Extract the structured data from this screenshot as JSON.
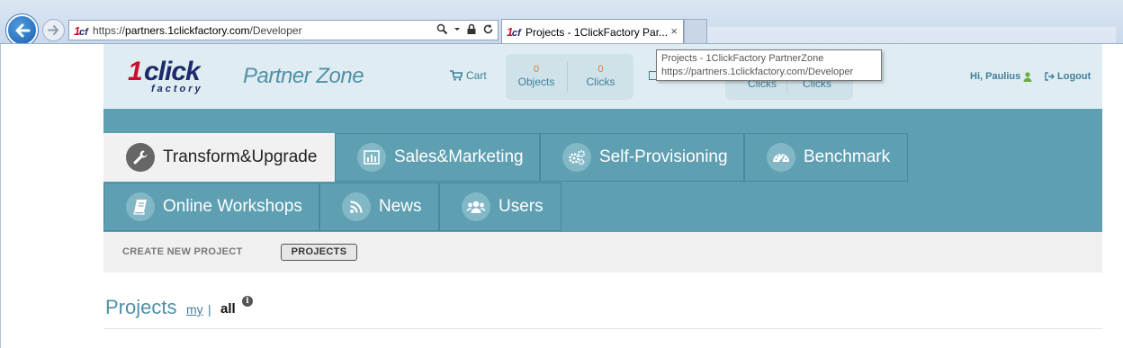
{
  "browser": {
    "address_url_prefix": "https://",
    "address_url_host": "partners.1clickfactory.com",
    "address_url_path": "/Developer",
    "tab_title": "Projects - 1ClickFactory Par...",
    "tab_close": "×",
    "tooltip_line1": "Projects - 1ClickFactory PartnerZone",
    "tooltip_line2": "https://partners.1clickfactory.com/Developer"
  },
  "header": {
    "logo_one": "1",
    "logo_click": "click",
    "logo_factory": "factory",
    "partner_zone": "Partner Zone",
    "cart_label": "Cart",
    "cart_objects_count": "0",
    "cart_objects_label": "Objects",
    "cart_clicks_count": "0",
    "cart_clicks_label": "Clicks",
    "box2_label_a": "Clicks",
    "box2_label_b": "Clicks",
    "greeting": "Hi, Paulius",
    "logout": "Logout"
  },
  "nav": {
    "items": [
      {
        "label": "Transform&Upgrade",
        "icon": "wrench-icon",
        "active": true
      },
      {
        "label": "Sales&Marketing",
        "icon": "bar-chart-icon",
        "active": false
      },
      {
        "label": "Self-Provisioning",
        "icon": "gears-icon",
        "active": false
      },
      {
        "label": "Benchmark",
        "icon": "dashboard-icon",
        "active": false
      },
      {
        "label": "Online Workshops",
        "icon": "book-icon",
        "active": false
      },
      {
        "label": "News",
        "icon": "rss-icon",
        "active": false
      },
      {
        "label": "Users",
        "icon": "users-icon",
        "active": false
      }
    ]
  },
  "subnav": {
    "create": "CREATE NEW PROJECT",
    "projects": "PROJECTS"
  },
  "page": {
    "title": "Projects",
    "filter_my": "my",
    "filter_sep": "|",
    "filter_all": "all",
    "info": "i"
  },
  "colors": {
    "teal": "#5e9fb2",
    "header_bg": "#dfedf2",
    "accent_orange": "#e57a2b",
    "logo_red": "#c8102e",
    "logo_navy": "#1d2a6b"
  }
}
